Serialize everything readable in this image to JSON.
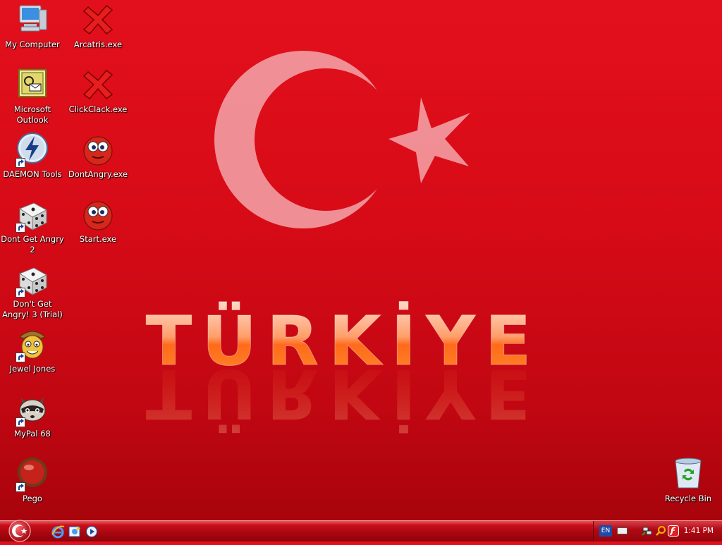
{
  "wallpaper": {
    "text": "TÜRKİYE"
  },
  "desktop_icons": [
    {
      "label": "My Computer",
      "icon": "my-computer-icon"
    },
    {
      "label": "Arcatris.exe",
      "icon": "red-x-icon"
    },
    {
      "label": "Microsoft Outlook",
      "icon": "outlook-icon"
    },
    {
      "label": "ClickClack.exe",
      "icon": "red-x-icon"
    },
    {
      "label": "DAEMON Tools",
      "icon": "daemon-tools-icon"
    },
    {
      "label": "DontAngry.exe",
      "icon": "red-ball-face-icon"
    },
    {
      "label": "Dont Get Angry 2",
      "icon": "dice-icon"
    },
    {
      "label": "Start.exe",
      "icon": "red-ball-face-icon"
    },
    {
      "label": "Don't Get Angry! 3 (Trial)",
      "icon": "dice-icon"
    },
    {
      "label": "Jewel Jones",
      "icon": "jewel-jones-icon"
    },
    {
      "label": "MyPal 68",
      "icon": "raccoon-icon"
    },
    {
      "label": "Pego",
      "icon": "red-button-icon"
    },
    {
      "label": "Recycle Bin",
      "icon": "recycle-bin-icon"
    }
  ],
  "taskbar": {
    "start_icon": "crescent-star-orb-icon",
    "quick_launch": [
      "internet-explorer-icon",
      "explorer-icon",
      "media-player-icon"
    ],
    "tray": {
      "language": "EN",
      "icons": [
        "keyboard-icon",
        "network-icon",
        "search-icon",
        "flash-icon"
      ],
      "clock": "1:41 PM"
    }
  },
  "colors": {
    "desktop_red": "#d70b17",
    "taskbar_red": "#a8060f"
  }
}
